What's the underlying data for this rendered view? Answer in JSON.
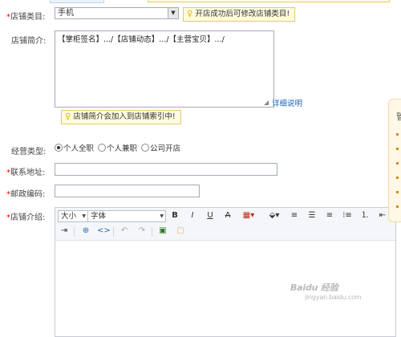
{
  "form": {
    "category": {
      "required_mark": "*",
      "label": "店铺类目:",
      "selected": "手机",
      "tip": "开店成功后可修改店铺类目!"
    },
    "intro": {
      "label": "店铺简介:",
      "value": "【掌柜签名】.../【店铺动态】.../【主营宝贝】.../",
      "help_link": "详细说明",
      "tip": "店铺简介会加入到店铺索引中!"
    },
    "business_type": {
      "label": "经营类型:",
      "options": [
        "个人全职",
        "个人兼职",
        "公司开店"
      ],
      "selected_index": 0
    },
    "address": {
      "required_mark": "*",
      "label": "联系地址:",
      "value": ""
    },
    "postcode": {
      "required_mark": "*",
      "label": "邮政编码:",
      "value": ""
    },
    "shop_intro": {
      "required_mark": "*",
      "label": "店铺介绍:",
      "toolbar": {
        "size_select": "大小",
        "font_select": "字体",
        "bold": "B",
        "italic": "I",
        "underline": "U",
        "strike": "A"
      }
    }
  },
  "side_panel": {
    "head": "管"
  },
  "watermark": {
    "main": "Baidu 经验",
    "sub": "jingyan.baidu.com"
  }
}
